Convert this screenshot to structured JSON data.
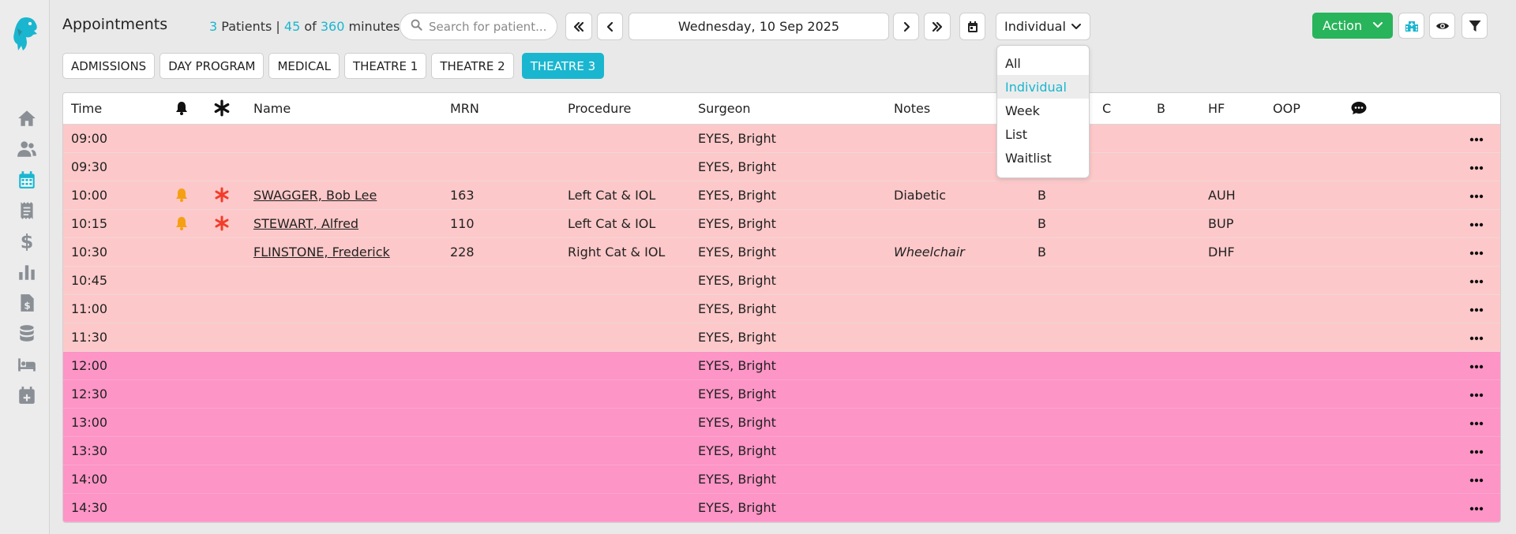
{
  "header": {
    "title": "Appointments",
    "stats": {
      "patients_count": "3",
      "patients_label": "Patients |",
      "minutes_used": "45",
      "of_label": "of",
      "minutes_total": "360",
      "minutes_label": "minutes"
    },
    "search": {
      "placeholder": "Search for patient...",
      "value": ""
    },
    "date": "Wednesday, 10 Sep 2025",
    "view_selected": "Individual",
    "action_label": "Action"
  },
  "view_options": [
    {
      "label": "All",
      "selected": false
    },
    {
      "label": "Individual",
      "selected": true
    },
    {
      "label": "Week",
      "selected": false
    },
    {
      "label": "List",
      "selected": false
    },
    {
      "label": "Waitlist",
      "selected": false
    }
  ],
  "tabs": [
    {
      "label": "ADMISSIONS",
      "active": false
    },
    {
      "label": "DAY PROGRAM",
      "active": false
    },
    {
      "label": "MEDICAL",
      "active": false
    },
    {
      "label": "THEATRE 1",
      "active": false
    },
    {
      "label": "THEATRE 2",
      "active": false
    },
    {
      "label": "THEATRE 3",
      "active": true
    }
  ],
  "sidebar": {
    "items": [
      {
        "name": "home-icon"
      },
      {
        "name": "patients-icon"
      },
      {
        "name": "calendar-icon",
        "active": true
      },
      {
        "name": "receipt-icon"
      },
      {
        "name": "dollar-icon"
      },
      {
        "name": "chart-icon"
      },
      {
        "name": "invoice-icon"
      },
      {
        "name": "database-icon"
      },
      {
        "name": "bed-icon"
      },
      {
        "name": "calendar-plus-icon"
      }
    ]
  },
  "table": {
    "columns": {
      "time": "Time",
      "name": "Name",
      "mrn": "MRN",
      "procedure": "Procedure",
      "surgeon": "Surgeon",
      "notes": "Notes",
      "c": "C",
      "b": "B",
      "hf": "HF",
      "oop": "OOP"
    },
    "rows": [
      {
        "time": "09:00",
        "alert": false,
        "flag": false,
        "name": "",
        "mrn": "",
        "procedure": "",
        "surgeon": "EYES, Bright",
        "notes": "",
        "notes_italic": false,
        "col_b": "",
        "hf": "",
        "shade": "light"
      },
      {
        "time": "09:30",
        "alert": false,
        "flag": false,
        "name": "",
        "mrn": "",
        "procedure": "",
        "surgeon": "EYES, Bright",
        "notes": "",
        "notes_italic": false,
        "col_b": "",
        "hf": "",
        "shade": "light"
      },
      {
        "time": "10:00",
        "alert": true,
        "flag": true,
        "name": "SWAGGER, Bob Lee",
        "mrn": "163",
        "procedure": "Left Cat & IOL",
        "surgeon": "EYES, Bright",
        "notes": "Diabetic",
        "notes_italic": false,
        "col_b": "B",
        "hf": "AUH",
        "shade": "light"
      },
      {
        "time": "10:15",
        "alert": true,
        "flag": true,
        "name": "STEWART, Alfred",
        "mrn": "110",
        "procedure": "Left Cat & IOL",
        "surgeon": "EYES, Bright",
        "notes": "",
        "notes_italic": false,
        "col_b": "B",
        "hf": "BUP",
        "shade": "light"
      },
      {
        "time": "10:30",
        "alert": false,
        "flag": false,
        "name": "FLINSTONE, Frederick",
        "mrn": "228",
        "procedure": "Right Cat & IOL",
        "surgeon": "EYES, Bright",
        "notes": "Wheelchair",
        "notes_italic": true,
        "col_b": "B",
        "hf": "DHF",
        "shade": "light"
      },
      {
        "time": "10:45",
        "alert": false,
        "flag": false,
        "name": "",
        "mrn": "",
        "procedure": "",
        "surgeon": "EYES, Bright",
        "notes": "",
        "notes_italic": false,
        "col_b": "",
        "hf": "",
        "shade": "light"
      },
      {
        "time": "11:00",
        "alert": false,
        "flag": false,
        "name": "",
        "mrn": "",
        "procedure": "",
        "surgeon": "EYES, Bright",
        "notes": "",
        "notes_italic": false,
        "col_b": "",
        "hf": "",
        "shade": "light"
      },
      {
        "time": "11:30",
        "alert": false,
        "flag": false,
        "name": "",
        "mrn": "",
        "procedure": "",
        "surgeon": "EYES, Bright",
        "notes": "",
        "notes_italic": false,
        "col_b": "",
        "hf": "",
        "shade": "light"
      },
      {
        "time": "12:00",
        "alert": false,
        "flag": false,
        "name": "",
        "mrn": "",
        "procedure": "",
        "surgeon": "EYES, Bright",
        "notes": "",
        "notes_italic": false,
        "col_b": "",
        "hf": "",
        "shade": "pink"
      },
      {
        "time": "12:30",
        "alert": false,
        "flag": false,
        "name": "",
        "mrn": "",
        "procedure": "",
        "surgeon": "EYES, Bright",
        "notes": "",
        "notes_italic": false,
        "col_b": "",
        "hf": "",
        "shade": "pink"
      },
      {
        "time": "13:00",
        "alert": false,
        "flag": false,
        "name": "",
        "mrn": "",
        "procedure": "",
        "surgeon": "EYES, Bright",
        "notes": "",
        "notes_italic": false,
        "col_b": "",
        "hf": "",
        "shade": "pink"
      },
      {
        "time": "13:30",
        "alert": false,
        "flag": false,
        "name": "",
        "mrn": "",
        "procedure": "",
        "surgeon": "EYES, Bright",
        "notes": "",
        "notes_italic": false,
        "col_b": "",
        "hf": "",
        "shade": "pink"
      },
      {
        "time": "14:00",
        "alert": false,
        "flag": false,
        "name": "",
        "mrn": "",
        "procedure": "",
        "surgeon": "EYES, Bright",
        "notes": "",
        "notes_italic": false,
        "col_b": "",
        "hf": "",
        "shade": "pink"
      },
      {
        "time": "14:30",
        "alert": false,
        "flag": false,
        "name": "",
        "mrn": "",
        "procedure": "",
        "surgeon": "EYES, Bright",
        "notes": "",
        "notes_italic": false,
        "col_b": "",
        "hf": "",
        "shade": "pink"
      }
    ]
  },
  "colors": {
    "accent": "#1ab6cf",
    "action_green": "#28b45a",
    "bell_orange": "#f5a012",
    "asterisk_red": "#f23d2a",
    "row_light": "#fdc8c9",
    "row_pink": "#fd95c6"
  }
}
